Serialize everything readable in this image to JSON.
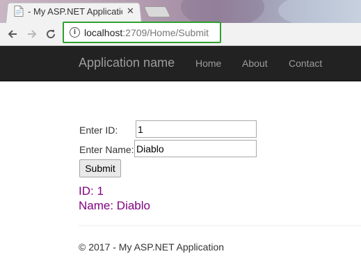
{
  "browser": {
    "tab_title": "- My ASP.NET Application",
    "tab_close": "✕",
    "address": {
      "host": "localhost",
      "path": ":2709/Home/Submit",
      "info": "i"
    }
  },
  "navbar": {
    "brand": "Application name",
    "links": [
      "Home",
      "About",
      "Contact"
    ],
    "background": "#222222",
    "link_color": "#9d9d9d"
  },
  "form": {
    "id_label": "Enter ID:",
    "id_value": "1",
    "name_label": "Enter Name:",
    "name_value": "Diablo",
    "submit_label": "Submit"
  },
  "result": {
    "id_line": "ID: 1",
    "name_line": "Name: Diablo",
    "color": "#800080"
  },
  "footer": {
    "text": "© 2017 - My ASP.NET Application"
  }
}
